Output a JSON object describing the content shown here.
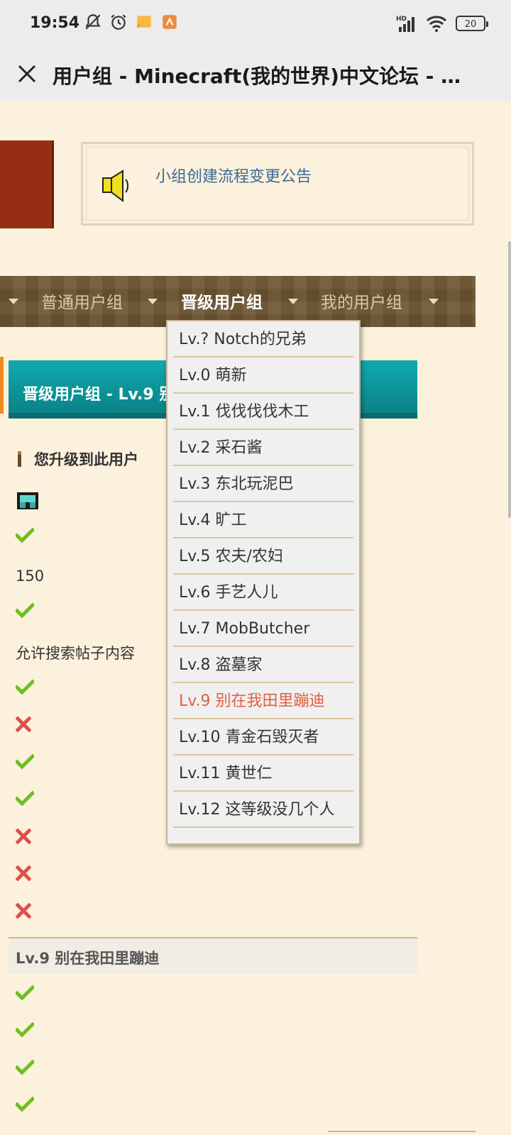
{
  "status_bar": {
    "time": "19:54",
    "network": "HD",
    "battery": "20"
  },
  "titlebar": {
    "title": "用户组 - Minecraft(我的世界)中文论坛 - …"
  },
  "notice": {
    "link_text": "小组创建流程变更公告"
  },
  "nav": {
    "items": [
      {
        "label": "普通用户组"
      },
      {
        "label": "晋级用户组"
      },
      {
        "label": "我的用户组"
      }
    ],
    "active_index": 1
  },
  "section": {
    "header_title": "晋级用户组 - Lv.9 别",
    "upgrade_text": "您升级到此用户",
    "value_150": "150",
    "search_perm": "允许搜索帖子内容",
    "subheader": "Lv.9 别在我田里蹦迪"
  },
  "rows": [
    {
      "kind": "check"
    },
    {
      "kind": "check"
    },
    {
      "kind": "check"
    },
    {
      "kind": "cross"
    },
    {
      "kind": "check"
    },
    {
      "kind": "check"
    },
    {
      "kind": "cross"
    },
    {
      "kind": "cross"
    },
    {
      "kind": "cross"
    }
  ],
  "rows_after": [
    "check",
    "check",
    "check",
    "check"
  ],
  "dropdown": {
    "items": [
      "Lv.? Notch的兄弟",
      "Lv.0 萌新",
      "Lv.1 伐伐伐伐木工",
      "Lv.2 采石酱",
      "Lv.3 东北玩泥巴",
      "Lv.4 旷工",
      "Lv.5 农夫/农妇",
      "Lv.6 手艺人儿",
      "Lv.7 MobButcher",
      "Lv.8 盗墓家",
      "Lv.9 别在我田里蹦迪",
      "Lv.10 青金石毁灭者",
      "Lv.11 黄世仁",
      "Lv.12 这等级没几个人"
    ],
    "selected_index": 10
  },
  "colors": {
    "page_bg": "#fbf1dc",
    "teal": "#0a9a9d",
    "selected_item": "#e25e45",
    "link": "#3a6a95",
    "check": "#6fbf1f",
    "cross": "#e0504a"
  }
}
